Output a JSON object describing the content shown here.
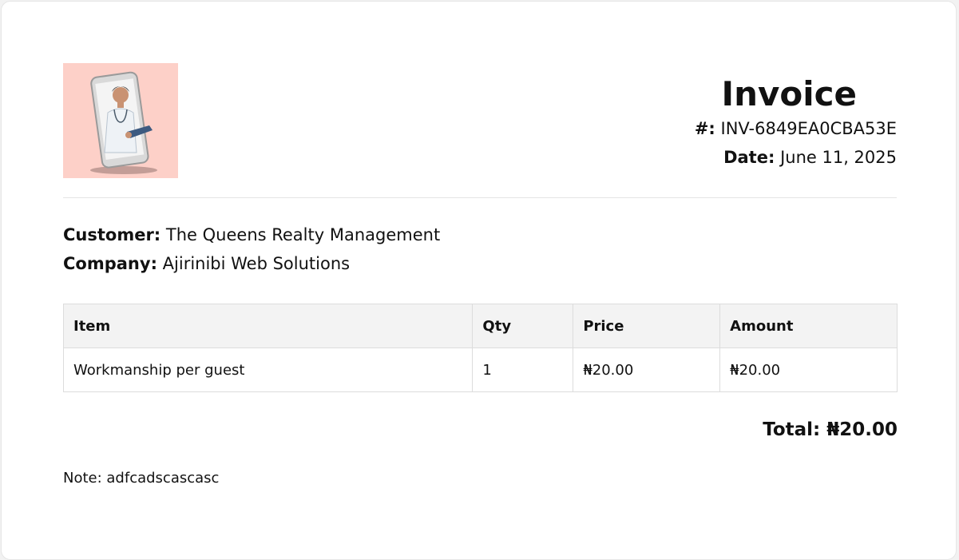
{
  "header": {
    "logo_icon": "doctor-in-phone-photo",
    "title": "Invoice",
    "number_label": "#:",
    "number_value": "INV-6849EA0CBA53E",
    "date_label": "Date:",
    "date_value": "June 11, 2025"
  },
  "parties": {
    "customer_label": "Customer:",
    "customer_value": "The Queens Realty Management",
    "company_label": "Company:",
    "company_value": "Ajirinibi Web Solutions"
  },
  "table": {
    "headers": [
      "Item",
      "Qty",
      "Price",
      "Amount"
    ],
    "rows": [
      [
        "Workmanship per guest",
        "1",
        "₦20.00",
        "₦20.00"
      ]
    ]
  },
  "total": {
    "text": "Total: ₦20.00"
  },
  "note": {
    "text": "Note: adfcadscascasc"
  },
  "colors": {
    "logo_background": "#fdd0c8",
    "header_row_background": "#f3f3f3",
    "border": "#dcdcdc"
  }
}
